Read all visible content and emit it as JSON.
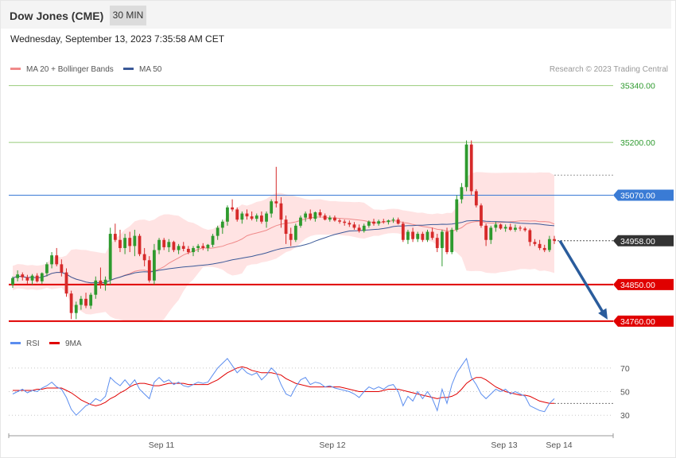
{
  "header": {
    "title": "Dow Jones (CME)",
    "timeframe": "30 MIN",
    "datetime": "Wednesday, September 13, 2023 7:35:58 AM CET"
  },
  "colors": {
    "up": "#2e9a2e",
    "down": "#d62a2a",
    "band": "#ffd9d9",
    "ma20": "#f08a8a",
    "ma50": "#3b5998",
    "green_level": "#98cc7a",
    "blue_level": "#3a7bd5",
    "red_level": "#e00000",
    "price_tag": "#333333",
    "arrow": "#2a5c9c",
    "rsi": "#5b8def",
    "rsi_ma": "#e00000"
  },
  "legend": {
    "ma20": "MA 20 + Bollinger Bands",
    "ma50": "MA 50",
    "source": "Research © 2023 Trading Central"
  },
  "rsi_legend": {
    "rsi": "RSI",
    "ma9": "9MA"
  },
  "chart_data": [
    {
      "type": "candlestick",
      "x_ticks": [
        "Sep 11",
        "Sep 12",
        "Sep 13",
        "Sep 14"
      ],
      "ylim": [
        34748,
        35355
      ],
      "grid": false,
      "legend_placement": "top-left",
      "levels": [
        {
          "value": 35340,
          "label": "35340.00",
          "kind": "resistance"
        },
        {
          "value": 35200,
          "label": "35200.00",
          "kind": "resistance"
        },
        {
          "value": 35070,
          "label": "35070.00",
          "kind": "pivot"
        },
        {
          "value": 34850,
          "label": "34850.00",
          "kind": "support"
        },
        {
          "value": 34760,
          "label": "34760.00",
          "kind": "support"
        }
      ],
      "last_price": {
        "value": 34958,
        "label": "34958.00"
      },
      "forecast": {
        "from": 34958,
        "to": 34760
      },
      "candles": [
        [
          34850,
          34870,
          34842,
          34866
        ],
        [
          34866,
          34885,
          34858,
          34875
        ],
        [
          34875,
          34880,
          34860,
          34868
        ],
        [
          34868,
          34874,
          34852,
          34860
        ],
        [
          34860,
          34876,
          34850,
          34872
        ],
        [
          34872,
          34878,
          34855,
          34858
        ],
        [
          34858,
          34880,
          34852,
          34878
        ],
        [
          34878,
          34905,
          34870,
          34900
        ],
        [
          34900,
          34930,
          34890,
          34922
        ],
        [
          34922,
          34940,
          34895,
          34900
        ],
        [
          34900,
          34912,
          34870,
          34880
        ],
        [
          34880,
          34890,
          34820,
          34828
        ],
        [
          34828,
          34835,
          34765,
          34780
        ],
        [
          34780,
          34808,
          34765,
          34800
        ],
        [
          34800,
          34822,
          34788,
          34815
        ],
        [
          34815,
          34830,
          34792,
          34798
        ],
        [
          34798,
          34830,
          34790,
          34825
        ],
        [
          34825,
          34870,
          34815,
          34860
        ],
        [
          34860,
          34892,
          34840,
          34850
        ],
        [
          34850,
          34870,
          34835,
          34862
        ],
        [
          34862,
          34990,
          34850,
          34975
        ],
        [
          34975,
          35000,
          34955,
          34960
        ],
        [
          34960,
          34985,
          34930,
          34940
        ],
        [
          34940,
          34975,
          34925,
          34965
        ],
        [
          34965,
          34980,
          34930,
          34945
        ],
        [
          34945,
          34985,
          34920,
          34970
        ],
        [
          34970,
          34975,
          34920,
          34925
        ],
        [
          34925,
          34940,
          34895,
          34910
        ],
        [
          34910,
          34920,
          34855,
          34860
        ],
        [
          34860,
          34950,
          34850,
          34935
        ],
        [
          34935,
          34965,
          34925,
          34960
        ],
        [
          34960,
          34965,
          34935,
          34942
        ],
        [
          34942,
          34962,
          34930,
          34955
        ],
        [
          34955,
          34958,
          34930,
          34935
        ],
        [
          34935,
          34950,
          34925,
          34945
        ],
        [
          34945,
          34955,
          34932,
          34938
        ],
        [
          34938,
          34945,
          34925,
          34930
        ],
        [
          34930,
          34945,
          34920,
          34940
        ],
        [
          34940,
          34950,
          34930,
          34945
        ],
        [
          34945,
          34952,
          34935,
          34940
        ],
        [
          34940,
          34950,
          34932,
          34948
        ],
        [
          34948,
          34975,
          34942,
          34970
        ],
        [
          34970,
          34995,
          34960,
          34990
        ],
        [
          34990,
          35010,
          34975,
          35005
        ],
        [
          35005,
          35045,
          34995,
          35040
        ],
        [
          35040,
          35060,
          35030,
          35035
        ],
        [
          35035,
          35040,
          35005,
          35010
        ],
        [
          35010,
          35030,
          35000,
          35025
        ],
        [
          35025,
          35035,
          35010,
          35018
        ],
        [
          35018,
          35030,
          35008,
          35012
        ],
        [
          35012,
          35025,
          35005,
          35020
        ],
        [
          35020,
          35030,
          35000,
          35005
        ],
        [
          35005,
          35030,
          34990,
          35025
        ],
        [
          35025,
          35060,
          35015,
          35055
        ],
        [
          35055,
          35140,
          35040,
          35050
        ],
        [
          35050,
          35065,
          34990,
          35010
        ],
        [
          35010,
          35020,
          34950,
          34975
        ],
        [
          34975,
          34990,
          34945,
          34960
        ],
        [
          34960,
          35000,
          34955,
          34995
        ],
        [
          34995,
          35020,
          34990,
          35015
        ],
        [
          35015,
          35030,
          35005,
          35025
        ],
        [
          35025,
          35035,
          35008,
          35012
        ],
        [
          35012,
          35030,
          35005,
          35028
        ],
        [
          35028,
          35035,
          35015,
          35020
        ],
        [
          35020,
          35025,
          35008,
          35010
        ],
        [
          35010,
          35020,
          35005,
          35015
        ],
        [
          35015,
          35020,
          35005,
          35008
        ],
        [
          35008,
          35012,
          35000,
          35005
        ],
        [
          35005,
          35010,
          34995,
          35002
        ],
        [
          35002,
          35008,
          34992,
          34998
        ],
        [
          34998,
          35004,
          34985,
          34990
        ],
        [
          34990,
          34998,
          34978,
          34982
        ],
        [
          34982,
          35000,
          34978,
          34995
        ],
        [
          34995,
          35008,
          34990,
          35005
        ],
        [
          35005,
          35012,
          34995,
          35000
        ],
        [
          35000,
          35010,
          34995,
          35006
        ],
        [
          35006,
          35012,
          35000,
          35004
        ],
        [
          35004,
          35010,
          34998,
          35008
        ],
        [
          35008,
          35015,
          35002,
          35010
        ],
        [
          35010,
          35015,
          34998,
          35000
        ],
        [
          35000,
          35005,
          34955,
          34960
        ],
        [
          34960,
          34985,
          34950,
          34980
        ],
        [
          34980,
          34990,
          34955,
          34962
        ],
        [
          34962,
          34980,
          34955,
          34975
        ],
        [
          34975,
          34980,
          34955,
          34960
        ],
        [
          34960,
          34985,
          34955,
          34980
        ],
        [
          34980,
          34990,
          34960,
          34965
        ],
        [
          34965,
          34975,
          34930,
          34940
        ],
        [
          34940,
          34985,
          34895,
          34980
        ],
        [
          34980,
          34990,
          34925,
          34930
        ],
        [
          34930,
          34990,
          34925,
          34985
        ],
        [
          34985,
          35070,
          34980,
          35060
        ],
        [
          35060,
          35100,
          35050,
          35090
        ],
        [
          35090,
          35205,
          35080,
          35195
        ],
        [
          35195,
          35205,
          35070,
          35080
        ],
        [
          35080,
          35085,
          35040,
          35045
        ],
        [
          35045,
          35050,
          34990,
          34995
        ],
        [
          34995,
          35000,
          34945,
          34960
        ],
        [
          34960,
          34995,
          34950,
          34990
        ],
        [
          34990,
          35005,
          34980,
          34998
        ],
        [
          34998,
          35000,
          34985,
          34988
        ],
        [
          34988,
          34998,
          34980,
          34992
        ],
        [
          34992,
          35000,
          34982,
          34985
        ],
        [
          34985,
          34998,
          34980,
          34990
        ],
        [
          34990,
          34995,
          34982,
          34988
        ],
        [
          34988,
          34992,
          34980,
          34984
        ],
        [
          34984,
          34988,
          34945,
          34955
        ],
        [
          34955,
          34962,
          34945,
          34950
        ],
        [
          34950,
          34960,
          34935,
          34940
        ],
        [
          34940,
          34948,
          34930,
          34935
        ],
        [
          34935,
          34970,
          34930,
          34962
        ],
        [
          34962,
          34970,
          34950,
          34958
        ]
      ]
    },
    {
      "type": "line",
      "y_ticks": [
        70,
        50,
        30
      ],
      "ylim": [
        18,
        82
      ],
      "series": [
        {
          "name": "RSI",
          "values": [
            48,
            50,
            52,
            49,
            51,
            50,
            53,
            55,
            58,
            54,
            52,
            45,
            35,
            30,
            34,
            38,
            40,
            44,
            42,
            46,
            62,
            58,
            55,
            60,
            55,
            60,
            52,
            48,
            44,
            58,
            62,
            58,
            60,
            56,
            58,
            55,
            54,
            56,
            58,
            57,
            58,
            64,
            70,
            74,
            78,
            72,
            66,
            70,
            66,
            64,
            66,
            60,
            64,
            70,
            66,
            56,
            48,
            46,
            54,
            60,
            62,
            56,
            58,
            57,
            54,
            55,
            53,
            52,
            51,
            50,
            48,
            45,
            50,
            54,
            52,
            54,
            52,
            55,
            56,
            50,
            38,
            46,
            42,
            50,
            44,
            50,
            44,
            34,
            52,
            40,
            56,
            66,
            72,
            78,
            62,
            56,
            48,
            44,
            48,
            52,
            50,
            52,
            48,
            50,
            48,
            46,
            38,
            36,
            34,
            33,
            40,
            44
          ]
        },
        {
          "name": "9MA",
          "values": [
            51,
            51,
            51,
            51,
            51,
            52,
            52,
            53,
            53,
            53,
            53,
            51,
            49,
            46,
            43,
            41,
            39,
            38,
            39,
            41,
            44,
            46,
            49,
            51,
            54,
            56,
            57,
            57,
            56,
            55,
            55,
            56,
            57,
            57,
            57,
            57,
            56,
            56,
            56,
            56,
            56,
            58,
            60,
            63,
            66,
            68,
            70,
            71,
            70,
            68,
            67,
            66,
            66,
            66,
            65,
            64,
            61,
            59,
            57,
            56,
            55,
            54,
            54,
            54,
            54,
            54,
            54,
            54,
            53,
            52,
            51,
            50,
            50,
            50,
            50,
            50,
            51,
            52,
            52,
            52,
            51,
            50,
            49,
            48,
            47,
            46,
            45,
            44,
            45,
            45,
            46,
            48,
            52,
            57,
            60,
            62,
            62,
            60,
            57,
            54,
            52,
            50,
            49,
            48,
            47,
            47,
            46,
            44,
            42,
            41,
            40,
            40
          ]
        }
      ]
    }
  ]
}
